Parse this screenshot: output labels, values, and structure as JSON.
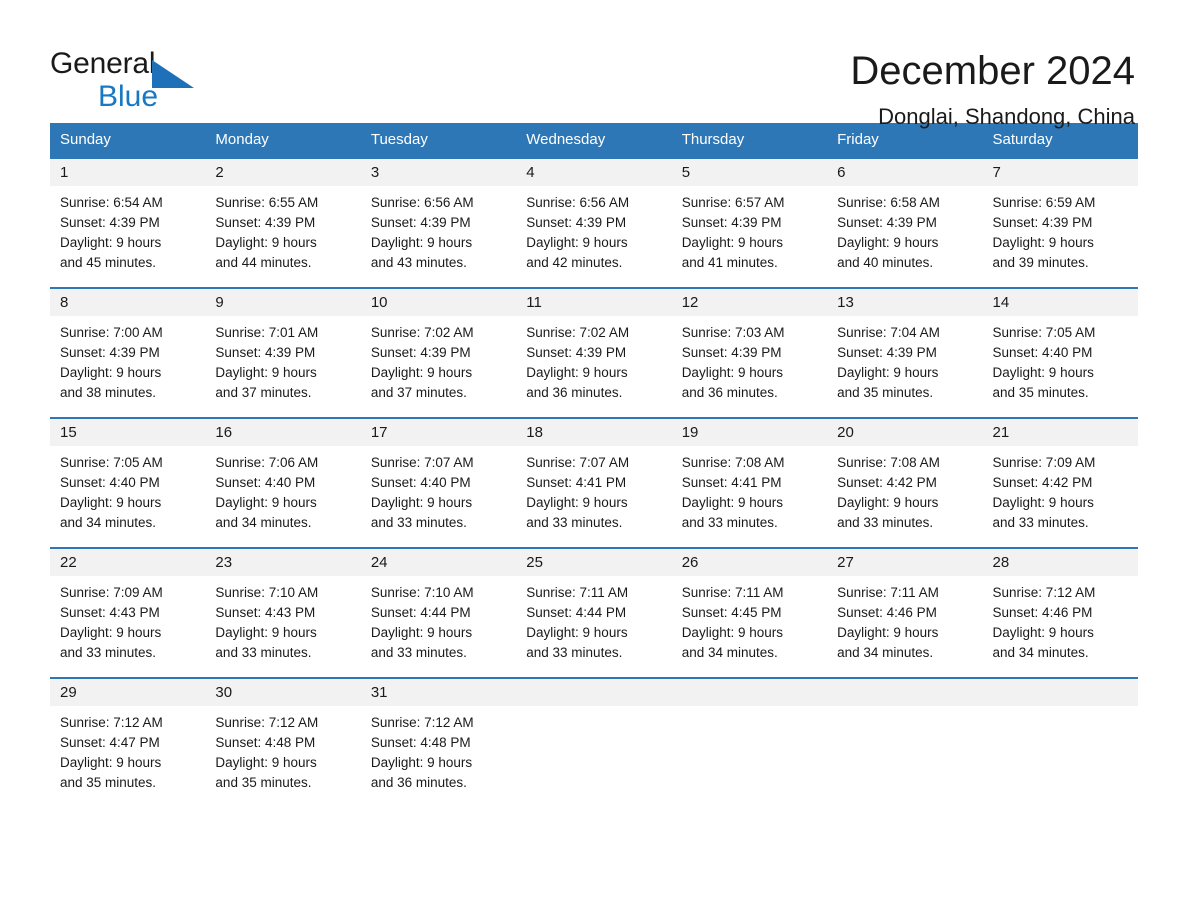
{
  "brand": {
    "name_top": "General",
    "name_bottom": "Blue",
    "accent_color": "#1878c4",
    "triangle_color": "#1e70b8"
  },
  "header": {
    "month_title": "December 2024",
    "location": "Donglai, Shandong, China"
  },
  "theme": {
    "header_row_bg": "#2e77b6",
    "header_row_text": "#ffffff",
    "date_band_bg": "#f2f2f2",
    "row_border": "#2e77b6",
    "page_bg": "#ffffff",
    "text": "#1a1a1a"
  },
  "calendar": {
    "day_headers": [
      "Sunday",
      "Monday",
      "Tuesday",
      "Wednesday",
      "Thursday",
      "Friday",
      "Saturday"
    ],
    "weeks": [
      [
        {
          "date": "1",
          "sunrise": "Sunrise: 6:54 AM",
          "sunset": "Sunset: 4:39 PM",
          "daylight1": "Daylight: 9 hours",
          "daylight2": "and 45 minutes."
        },
        {
          "date": "2",
          "sunrise": "Sunrise: 6:55 AM",
          "sunset": "Sunset: 4:39 PM",
          "daylight1": "Daylight: 9 hours",
          "daylight2": "and 44 minutes."
        },
        {
          "date": "3",
          "sunrise": "Sunrise: 6:56 AM",
          "sunset": "Sunset: 4:39 PM",
          "daylight1": "Daylight: 9 hours",
          "daylight2": "and 43 minutes."
        },
        {
          "date": "4",
          "sunrise": "Sunrise: 6:56 AM",
          "sunset": "Sunset: 4:39 PM",
          "daylight1": "Daylight: 9 hours",
          "daylight2": "and 42 minutes."
        },
        {
          "date": "5",
          "sunrise": "Sunrise: 6:57 AM",
          "sunset": "Sunset: 4:39 PM",
          "daylight1": "Daylight: 9 hours",
          "daylight2": "and 41 minutes."
        },
        {
          "date": "6",
          "sunrise": "Sunrise: 6:58 AM",
          "sunset": "Sunset: 4:39 PM",
          "daylight1": "Daylight: 9 hours",
          "daylight2": "and 40 minutes."
        },
        {
          "date": "7",
          "sunrise": "Sunrise: 6:59 AM",
          "sunset": "Sunset: 4:39 PM",
          "daylight1": "Daylight: 9 hours",
          "daylight2": "and 39 minutes."
        }
      ],
      [
        {
          "date": "8",
          "sunrise": "Sunrise: 7:00 AM",
          "sunset": "Sunset: 4:39 PM",
          "daylight1": "Daylight: 9 hours",
          "daylight2": "and 38 minutes."
        },
        {
          "date": "9",
          "sunrise": "Sunrise: 7:01 AM",
          "sunset": "Sunset: 4:39 PM",
          "daylight1": "Daylight: 9 hours",
          "daylight2": "and 37 minutes."
        },
        {
          "date": "10",
          "sunrise": "Sunrise: 7:02 AM",
          "sunset": "Sunset: 4:39 PM",
          "daylight1": "Daylight: 9 hours",
          "daylight2": "and 37 minutes."
        },
        {
          "date": "11",
          "sunrise": "Sunrise: 7:02 AM",
          "sunset": "Sunset: 4:39 PM",
          "daylight1": "Daylight: 9 hours",
          "daylight2": "and 36 minutes."
        },
        {
          "date": "12",
          "sunrise": "Sunrise: 7:03 AM",
          "sunset": "Sunset: 4:39 PM",
          "daylight1": "Daylight: 9 hours",
          "daylight2": "and 36 minutes."
        },
        {
          "date": "13",
          "sunrise": "Sunrise: 7:04 AM",
          "sunset": "Sunset: 4:39 PM",
          "daylight1": "Daylight: 9 hours",
          "daylight2": "and 35 minutes."
        },
        {
          "date": "14",
          "sunrise": "Sunrise: 7:05 AM",
          "sunset": "Sunset: 4:40 PM",
          "daylight1": "Daylight: 9 hours",
          "daylight2": "and 35 minutes."
        }
      ],
      [
        {
          "date": "15",
          "sunrise": "Sunrise: 7:05 AM",
          "sunset": "Sunset: 4:40 PM",
          "daylight1": "Daylight: 9 hours",
          "daylight2": "and 34 minutes."
        },
        {
          "date": "16",
          "sunrise": "Sunrise: 7:06 AM",
          "sunset": "Sunset: 4:40 PM",
          "daylight1": "Daylight: 9 hours",
          "daylight2": "and 34 minutes."
        },
        {
          "date": "17",
          "sunrise": "Sunrise: 7:07 AM",
          "sunset": "Sunset: 4:40 PM",
          "daylight1": "Daylight: 9 hours",
          "daylight2": "and 33 minutes."
        },
        {
          "date": "18",
          "sunrise": "Sunrise: 7:07 AM",
          "sunset": "Sunset: 4:41 PM",
          "daylight1": "Daylight: 9 hours",
          "daylight2": "and 33 minutes."
        },
        {
          "date": "19",
          "sunrise": "Sunrise: 7:08 AM",
          "sunset": "Sunset: 4:41 PM",
          "daylight1": "Daylight: 9 hours",
          "daylight2": "and 33 minutes."
        },
        {
          "date": "20",
          "sunrise": "Sunrise: 7:08 AM",
          "sunset": "Sunset: 4:42 PM",
          "daylight1": "Daylight: 9 hours",
          "daylight2": "and 33 minutes."
        },
        {
          "date": "21",
          "sunrise": "Sunrise: 7:09 AM",
          "sunset": "Sunset: 4:42 PM",
          "daylight1": "Daylight: 9 hours",
          "daylight2": "and 33 minutes."
        }
      ],
      [
        {
          "date": "22",
          "sunrise": "Sunrise: 7:09 AM",
          "sunset": "Sunset: 4:43 PM",
          "daylight1": "Daylight: 9 hours",
          "daylight2": "and 33 minutes."
        },
        {
          "date": "23",
          "sunrise": "Sunrise: 7:10 AM",
          "sunset": "Sunset: 4:43 PM",
          "daylight1": "Daylight: 9 hours",
          "daylight2": "and 33 minutes."
        },
        {
          "date": "24",
          "sunrise": "Sunrise: 7:10 AM",
          "sunset": "Sunset: 4:44 PM",
          "daylight1": "Daylight: 9 hours",
          "daylight2": "and 33 minutes."
        },
        {
          "date": "25",
          "sunrise": "Sunrise: 7:11 AM",
          "sunset": "Sunset: 4:44 PM",
          "daylight1": "Daylight: 9 hours",
          "daylight2": "and 33 minutes."
        },
        {
          "date": "26",
          "sunrise": "Sunrise: 7:11 AM",
          "sunset": "Sunset: 4:45 PM",
          "daylight1": "Daylight: 9 hours",
          "daylight2": "and 34 minutes."
        },
        {
          "date": "27",
          "sunrise": "Sunrise: 7:11 AM",
          "sunset": "Sunset: 4:46 PM",
          "daylight1": "Daylight: 9 hours",
          "daylight2": "and 34 minutes."
        },
        {
          "date": "28",
          "sunrise": "Sunrise: 7:12 AM",
          "sunset": "Sunset: 4:46 PM",
          "daylight1": "Daylight: 9 hours",
          "daylight2": "and 34 minutes."
        }
      ],
      [
        {
          "date": "29",
          "sunrise": "Sunrise: 7:12 AM",
          "sunset": "Sunset: 4:47 PM",
          "daylight1": "Daylight: 9 hours",
          "daylight2": "and 35 minutes."
        },
        {
          "date": "30",
          "sunrise": "Sunrise: 7:12 AM",
          "sunset": "Sunset: 4:48 PM",
          "daylight1": "Daylight: 9 hours",
          "daylight2": "and 35 minutes."
        },
        {
          "date": "31",
          "sunrise": "Sunrise: 7:12 AM",
          "sunset": "Sunset: 4:48 PM",
          "daylight1": "Daylight: 9 hours",
          "daylight2": "and 36 minutes."
        },
        {
          "date": "",
          "sunrise": "",
          "sunset": "",
          "daylight1": "",
          "daylight2": "",
          "blank": true
        },
        {
          "date": "",
          "sunrise": "",
          "sunset": "",
          "daylight1": "",
          "daylight2": "",
          "blank": true
        },
        {
          "date": "",
          "sunrise": "",
          "sunset": "",
          "daylight1": "",
          "daylight2": "",
          "blank": true
        },
        {
          "date": "",
          "sunrise": "",
          "sunset": "",
          "daylight1": "",
          "daylight2": "",
          "blank": true
        }
      ]
    ]
  }
}
